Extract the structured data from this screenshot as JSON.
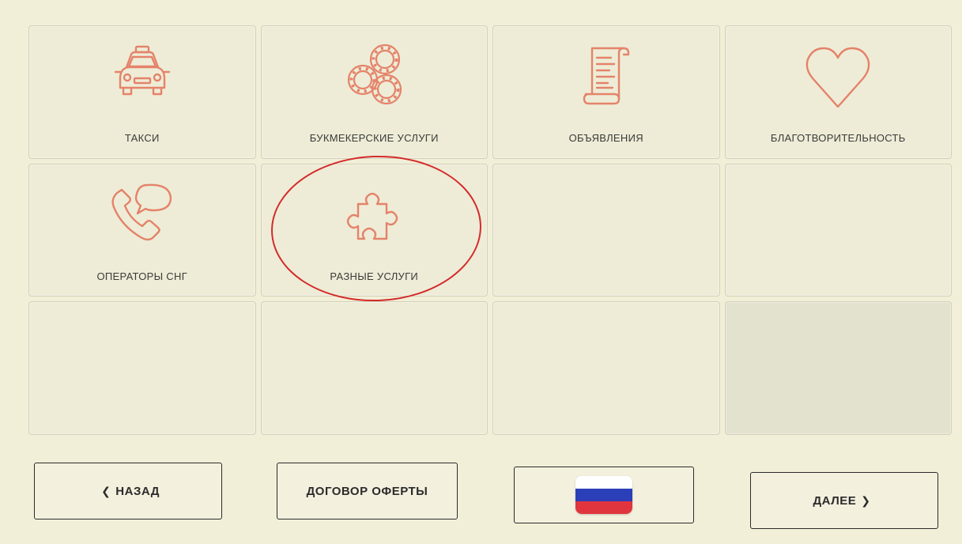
{
  "colors": {
    "background": "#f1efd7",
    "icon_stroke": "#e4836a",
    "highlight": "#d42a2a",
    "flag_white": "#ffffff",
    "flag_blue": "#2a3fb8",
    "flag_red": "#e0353f"
  },
  "tiles": [
    {
      "label": "ТАКСИ",
      "icon": "taxi-icon"
    },
    {
      "label": "БУКМЕКЕРСКИЕ УСЛУГИ",
      "icon": "casino-chips-icon"
    },
    {
      "label": "ОБЪЯВЛЕНИЯ",
      "icon": "scroll-icon"
    },
    {
      "label": "БЛАГОТВОРИТЕЛЬНОСТЬ",
      "icon": "heart-icon"
    },
    {
      "label": "ОПЕРАТОРЫ СНГ",
      "icon": "phone-chat-icon"
    },
    {
      "label": "РАЗНЫЕ УСЛУГИ",
      "icon": "puzzle-icon"
    }
  ],
  "footer": {
    "back_label": "НАЗАД",
    "offer_label": "ДОГОВОР ОФЕРТЫ",
    "next_label": "ДАЛЕЕ",
    "language_icon": "russian-flag-icon"
  }
}
